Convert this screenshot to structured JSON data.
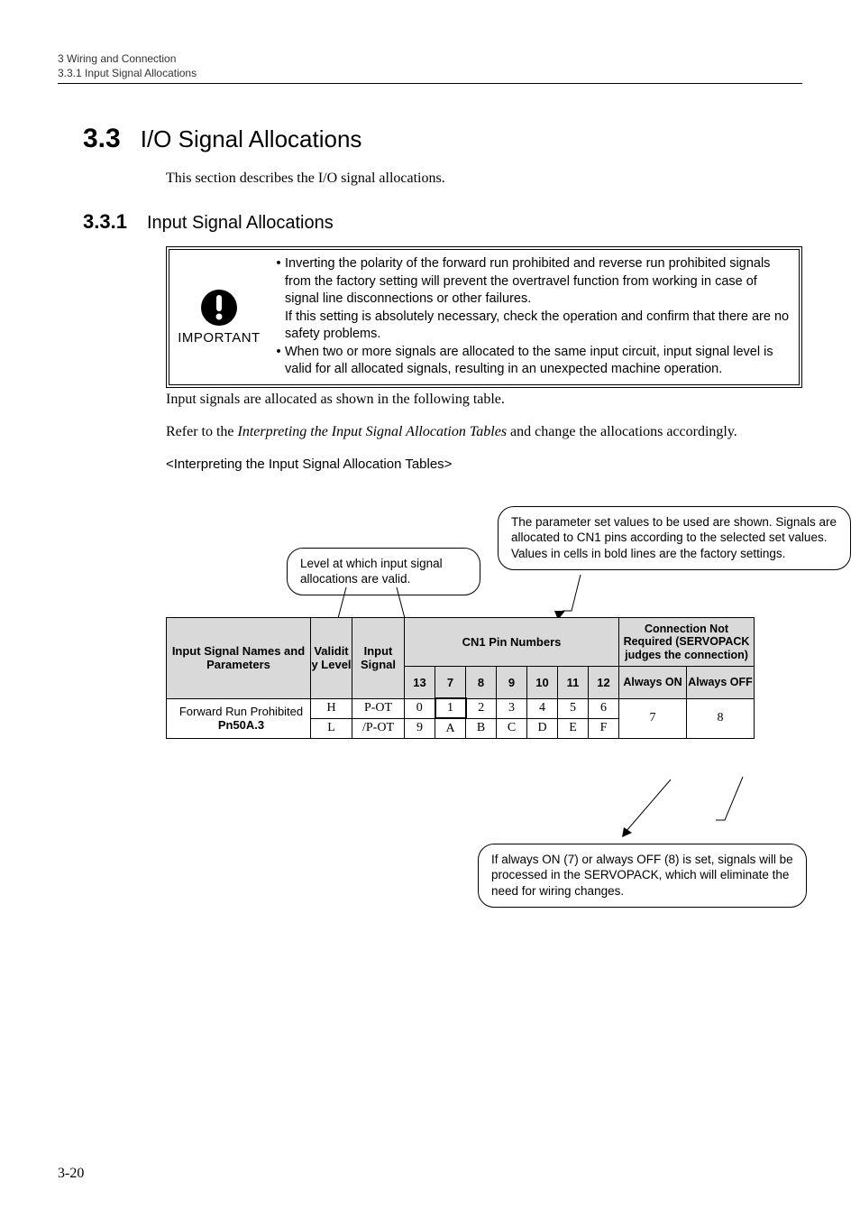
{
  "header": {
    "chapter": "3  Wiring and Connection",
    "subsection_ref": "3.3.1  Input Signal Allocations"
  },
  "section": {
    "number": "3.3",
    "title": "I/O Signal Allocations",
    "intro": "This section describes the I/O signal allocations."
  },
  "subsection": {
    "number": "3.3.1",
    "title": "Input Signal Allocations"
  },
  "important": {
    "label": "IMPORTANT",
    "items": [
      {
        "main": "Inverting the polarity of the forward run prohibited and reverse run prohibited signals from the factory setting will prevent the overtravel function from working in case of signal line disconnections or other failures.",
        "sub": "If this setting is absolutely necessary, check the operation and confirm that there are no safety problems."
      },
      {
        "main": "When two or more signals are allocated to the same input circuit, input signal level is valid for all allocated signals, resulting in an unexpected machine operation."
      }
    ]
  },
  "body": {
    "p1": "Input signals are allocated as shown in the following table.",
    "p2_a": "Refer to the ",
    "p2_i": "Interpreting the Input Signal Allocation Tables",
    "p2_b": " and change the allocations accordingly.",
    "angle": "<Interpreting the Input Signal Allocation Tables>"
  },
  "callouts": {
    "c1": "Level at which input signal allocations are valid.",
    "c2": "The parameter set values to be used are shown. Signals are allocated to CN1 pins according to the selected set values.\nValues in cells in bold lines are the factory settings.",
    "c3": "If always ON (7) or always OFF (8) is set, signals will be processed in the SERVOPACK, which will eliminate the need for wiring changes."
  },
  "table": {
    "headers": {
      "name": "Input Signal Names and Parameters",
      "validity": "Validity Level",
      "input": "Input Signal",
      "cn1": "CN1 Pin Numbers",
      "conn": "Connection Not Required (SERVOPACK judges the connection)",
      "pins": [
        "13",
        "7",
        "8",
        "9",
        "10",
        "11",
        "12"
      ],
      "always_on": "Always ON",
      "always_off": "Always OFF"
    },
    "rows": [
      {
        "name_line1": "Forward Run Prohibited",
        "name_line2": "Pn50A.3",
        "levels": [
          "H",
          "L"
        ],
        "signals": [
          "P-OT",
          "/P-OT"
        ],
        "vals_h": [
          "0",
          "1",
          "2",
          "3",
          "4",
          "5",
          "6"
        ],
        "vals_l": [
          "9",
          "A",
          "B",
          "C",
          "D",
          "E",
          "F"
        ],
        "conn": [
          "7",
          "8"
        ]
      }
    ]
  },
  "page": "3-20"
}
